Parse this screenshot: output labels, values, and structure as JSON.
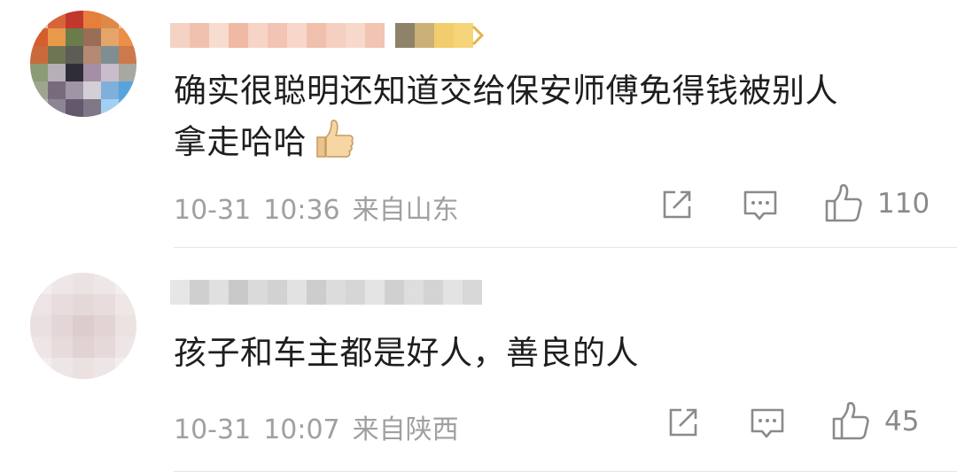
{
  "comments": [
    {
      "text_line1": "确实很聪明还知道交给保安师傅免得钱被别人",
      "text_line2": "拿走哈哈",
      "emoji": "thumbs-up-emoji",
      "date": "10-31",
      "time": "10:36",
      "location": "来自山东",
      "likes": "110"
    },
    {
      "text_line1": "孩子和车主都是好人，善良的人",
      "date": "10-31",
      "time": "10:07",
      "location": "来自陕西",
      "likes": "45"
    }
  ],
  "icons": {
    "share": "share-icon",
    "reply": "comment-icon",
    "like": "thumbs-up-icon"
  },
  "colors": {
    "meta_gray": "#a0a0a0",
    "icon_gray": "#8a8a8a",
    "divider": "#e6e6e6"
  }
}
